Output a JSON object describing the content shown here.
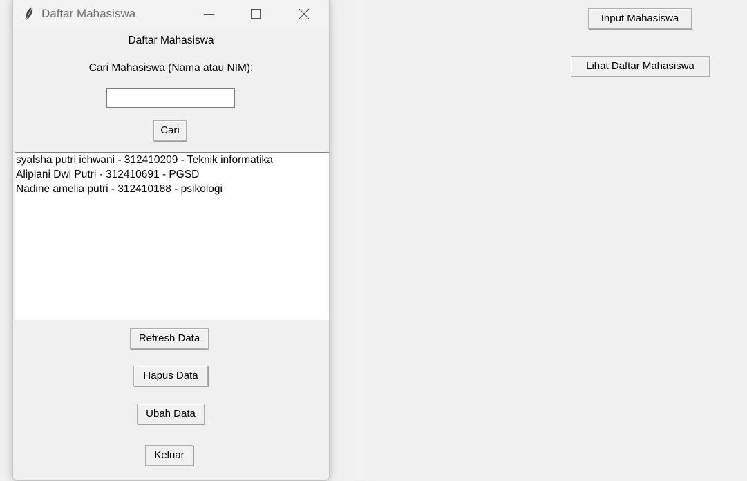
{
  "main_window": {
    "input_button": "Input Mahasiswa",
    "list_button": "Lihat Daftar Mahasiswa"
  },
  "child_window": {
    "title": "Daftar Mahasiswa",
    "heading": "Daftar Mahasiswa",
    "search_label": "Cari Mahasiswa (Nama atau NIM):",
    "search_value": "",
    "search_button": "Cari",
    "list_items": [
      "syalsha putri ichwani - 312410209 - Teknik informatika",
      "Alipiani Dwi Putri - 312410691 - PGSD",
      "Nadine amelia putri - 312410188 - psikologi"
    ],
    "refresh_button": "Refresh Data",
    "delete_button": "Hapus Data",
    "edit_button": "Ubah Data",
    "exit_button": "Keluar"
  }
}
